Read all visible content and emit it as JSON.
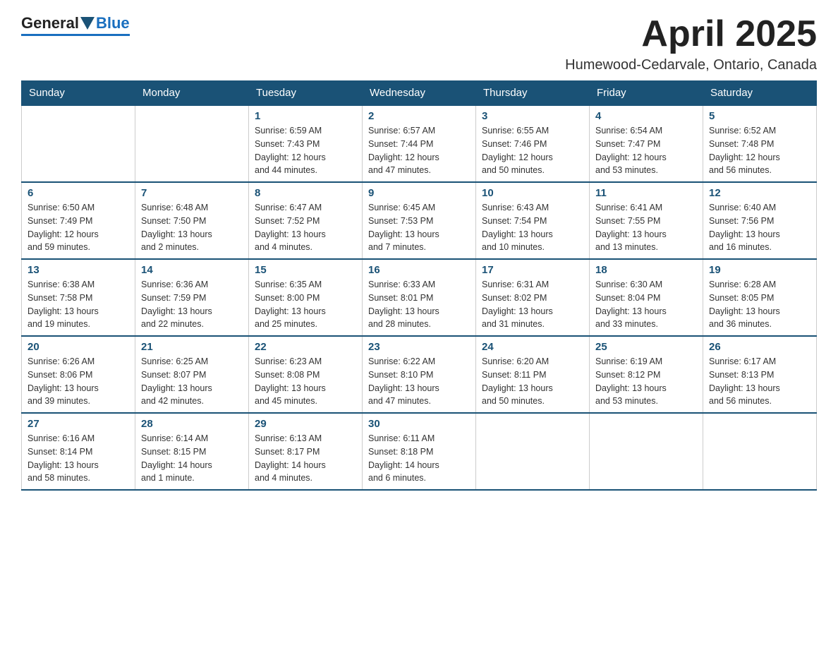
{
  "header": {
    "logo_general": "General",
    "logo_blue": "Blue",
    "month_title": "April 2025",
    "location": "Humewood-Cedarvale, Ontario, Canada"
  },
  "weekdays": [
    "Sunday",
    "Monday",
    "Tuesday",
    "Wednesday",
    "Thursday",
    "Friday",
    "Saturday"
  ],
  "weeks": [
    [
      {
        "day": "",
        "info": ""
      },
      {
        "day": "",
        "info": ""
      },
      {
        "day": "1",
        "info": "Sunrise: 6:59 AM\nSunset: 7:43 PM\nDaylight: 12 hours\nand 44 minutes."
      },
      {
        "day": "2",
        "info": "Sunrise: 6:57 AM\nSunset: 7:44 PM\nDaylight: 12 hours\nand 47 minutes."
      },
      {
        "day": "3",
        "info": "Sunrise: 6:55 AM\nSunset: 7:46 PM\nDaylight: 12 hours\nand 50 minutes."
      },
      {
        "day": "4",
        "info": "Sunrise: 6:54 AM\nSunset: 7:47 PM\nDaylight: 12 hours\nand 53 minutes."
      },
      {
        "day": "5",
        "info": "Sunrise: 6:52 AM\nSunset: 7:48 PM\nDaylight: 12 hours\nand 56 minutes."
      }
    ],
    [
      {
        "day": "6",
        "info": "Sunrise: 6:50 AM\nSunset: 7:49 PM\nDaylight: 12 hours\nand 59 minutes."
      },
      {
        "day": "7",
        "info": "Sunrise: 6:48 AM\nSunset: 7:50 PM\nDaylight: 13 hours\nand 2 minutes."
      },
      {
        "day": "8",
        "info": "Sunrise: 6:47 AM\nSunset: 7:52 PM\nDaylight: 13 hours\nand 4 minutes."
      },
      {
        "day": "9",
        "info": "Sunrise: 6:45 AM\nSunset: 7:53 PM\nDaylight: 13 hours\nand 7 minutes."
      },
      {
        "day": "10",
        "info": "Sunrise: 6:43 AM\nSunset: 7:54 PM\nDaylight: 13 hours\nand 10 minutes."
      },
      {
        "day": "11",
        "info": "Sunrise: 6:41 AM\nSunset: 7:55 PM\nDaylight: 13 hours\nand 13 minutes."
      },
      {
        "day": "12",
        "info": "Sunrise: 6:40 AM\nSunset: 7:56 PM\nDaylight: 13 hours\nand 16 minutes."
      }
    ],
    [
      {
        "day": "13",
        "info": "Sunrise: 6:38 AM\nSunset: 7:58 PM\nDaylight: 13 hours\nand 19 minutes."
      },
      {
        "day": "14",
        "info": "Sunrise: 6:36 AM\nSunset: 7:59 PM\nDaylight: 13 hours\nand 22 minutes."
      },
      {
        "day": "15",
        "info": "Sunrise: 6:35 AM\nSunset: 8:00 PM\nDaylight: 13 hours\nand 25 minutes."
      },
      {
        "day": "16",
        "info": "Sunrise: 6:33 AM\nSunset: 8:01 PM\nDaylight: 13 hours\nand 28 minutes."
      },
      {
        "day": "17",
        "info": "Sunrise: 6:31 AM\nSunset: 8:02 PM\nDaylight: 13 hours\nand 31 minutes."
      },
      {
        "day": "18",
        "info": "Sunrise: 6:30 AM\nSunset: 8:04 PM\nDaylight: 13 hours\nand 33 minutes."
      },
      {
        "day": "19",
        "info": "Sunrise: 6:28 AM\nSunset: 8:05 PM\nDaylight: 13 hours\nand 36 minutes."
      }
    ],
    [
      {
        "day": "20",
        "info": "Sunrise: 6:26 AM\nSunset: 8:06 PM\nDaylight: 13 hours\nand 39 minutes."
      },
      {
        "day": "21",
        "info": "Sunrise: 6:25 AM\nSunset: 8:07 PM\nDaylight: 13 hours\nand 42 minutes."
      },
      {
        "day": "22",
        "info": "Sunrise: 6:23 AM\nSunset: 8:08 PM\nDaylight: 13 hours\nand 45 minutes."
      },
      {
        "day": "23",
        "info": "Sunrise: 6:22 AM\nSunset: 8:10 PM\nDaylight: 13 hours\nand 47 minutes."
      },
      {
        "day": "24",
        "info": "Sunrise: 6:20 AM\nSunset: 8:11 PM\nDaylight: 13 hours\nand 50 minutes."
      },
      {
        "day": "25",
        "info": "Sunrise: 6:19 AM\nSunset: 8:12 PM\nDaylight: 13 hours\nand 53 minutes."
      },
      {
        "day": "26",
        "info": "Sunrise: 6:17 AM\nSunset: 8:13 PM\nDaylight: 13 hours\nand 56 minutes."
      }
    ],
    [
      {
        "day": "27",
        "info": "Sunrise: 6:16 AM\nSunset: 8:14 PM\nDaylight: 13 hours\nand 58 minutes."
      },
      {
        "day": "28",
        "info": "Sunrise: 6:14 AM\nSunset: 8:15 PM\nDaylight: 14 hours\nand 1 minute."
      },
      {
        "day": "29",
        "info": "Sunrise: 6:13 AM\nSunset: 8:17 PM\nDaylight: 14 hours\nand 4 minutes."
      },
      {
        "day": "30",
        "info": "Sunrise: 6:11 AM\nSunset: 8:18 PM\nDaylight: 14 hours\nand 6 minutes."
      },
      {
        "day": "",
        "info": ""
      },
      {
        "day": "",
        "info": ""
      },
      {
        "day": "",
        "info": ""
      }
    ]
  ]
}
